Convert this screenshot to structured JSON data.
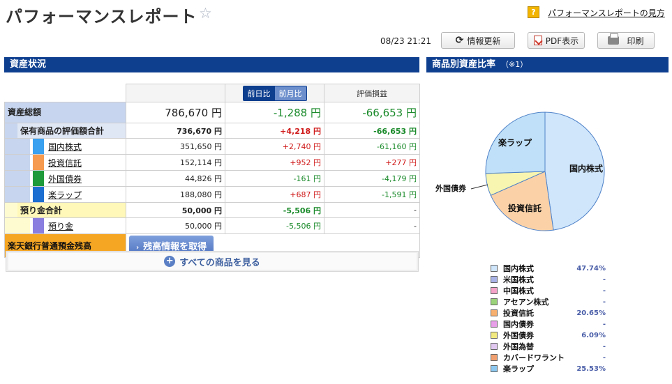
{
  "header": {
    "title": "パフォーマンスレポート",
    "help_icon": "?",
    "help_link": "パフォーマンスレポートの見方",
    "update_time": "08/23 21:21",
    "refresh_label": "情報更新",
    "pdf_label": "PDF表示",
    "print_label": "印刷"
  },
  "asset_section": {
    "title": "資産状況",
    "toggle_day": "前日比",
    "toggle_month": "前月比",
    "eval_header": "評価損益",
    "total": {
      "label": "資産総額",
      "value": "786,670 円",
      "change": "-1,288 円",
      "pl": "-66,653 円"
    },
    "holdings": {
      "label": "保有商品の評価額合計",
      "value": "736,670 円",
      "change": "+4,218 円",
      "pl": "-66,653 円"
    },
    "items": [
      {
        "label": "国内株式",
        "value": "351,650 円",
        "change": "+2,740 円",
        "pl": "-61,160 円",
        "color": "#3aa0f0"
      },
      {
        "label": "投資信託",
        "value": "152,114 円",
        "change": "+952 円",
        "pl": "+277 円",
        "color": "#f59a4f"
      },
      {
        "label": "外国債券",
        "value": "44,826 円",
        "change": "-161 円",
        "pl": "-4,179 円",
        "color": "#1f9a3a"
      },
      {
        "label": "楽ラップ",
        "value": "188,080 円",
        "change": "+687 円",
        "pl": "-1,591 円",
        "color": "#1c6fd0"
      }
    ],
    "deposit_total": {
      "label": "預り金合計",
      "value": "50,000 円",
      "change": "-5,506 円",
      "pl": "-"
    },
    "deposit": {
      "label": "預り金",
      "value": "50,000 円",
      "change": "-5,506 円",
      "pl": "-",
      "color": "#8a7ee0"
    },
    "bank": {
      "label": "楽天銀行普通預金残高",
      "button": "残高情報を取得"
    },
    "view_all": "すべての商品を見る"
  },
  "ratio_section": {
    "title": "商品別資産比率",
    "note": "（※1）"
  },
  "chart_data": {
    "type": "pie",
    "slices": [
      {
        "name": "国内株式",
        "value": 47.74,
        "color": "#cfe6fb"
      },
      {
        "name": "投資信託",
        "value": 20.65,
        "color": "#fbd2a8"
      },
      {
        "name": "外国債券",
        "value": 6.09,
        "color": "#f8f5b0"
      },
      {
        "name": "楽ラップ",
        "value": 25.53,
        "color": "#bfe0f8"
      }
    ],
    "labels": {
      "kokunai": "国内株式",
      "toushin": "投資信託",
      "gaisai": "外国債券",
      "rakurap": "楽ラップ"
    }
  },
  "legend": [
    {
      "name": "国内株式",
      "value": "47.74%",
      "color": "#cfe6fb"
    },
    {
      "name": "米国株式",
      "value": "-",
      "color": "#aab3e6"
    },
    {
      "name": "中国株式",
      "value": "-",
      "color": "#f5a3c8"
    },
    {
      "name": "アセアン株式",
      "value": "-",
      "color": "#9ad37a"
    },
    {
      "name": "投資信託",
      "value": "20.65%",
      "color": "#f8b070"
    },
    {
      "name": "国内債券",
      "value": "-",
      "color": "#e8a0e8"
    },
    {
      "name": "外国債券",
      "value": "6.09%",
      "color": "#f2ea80"
    },
    {
      "name": "外国為替",
      "value": "-",
      "color": "#e0c8f0"
    },
    {
      "name": "カバードワラント",
      "value": "-",
      "color": "#f0a070"
    },
    {
      "name": "楽ラップ",
      "value": "25.53%",
      "color": "#8cc8f0"
    }
  ]
}
